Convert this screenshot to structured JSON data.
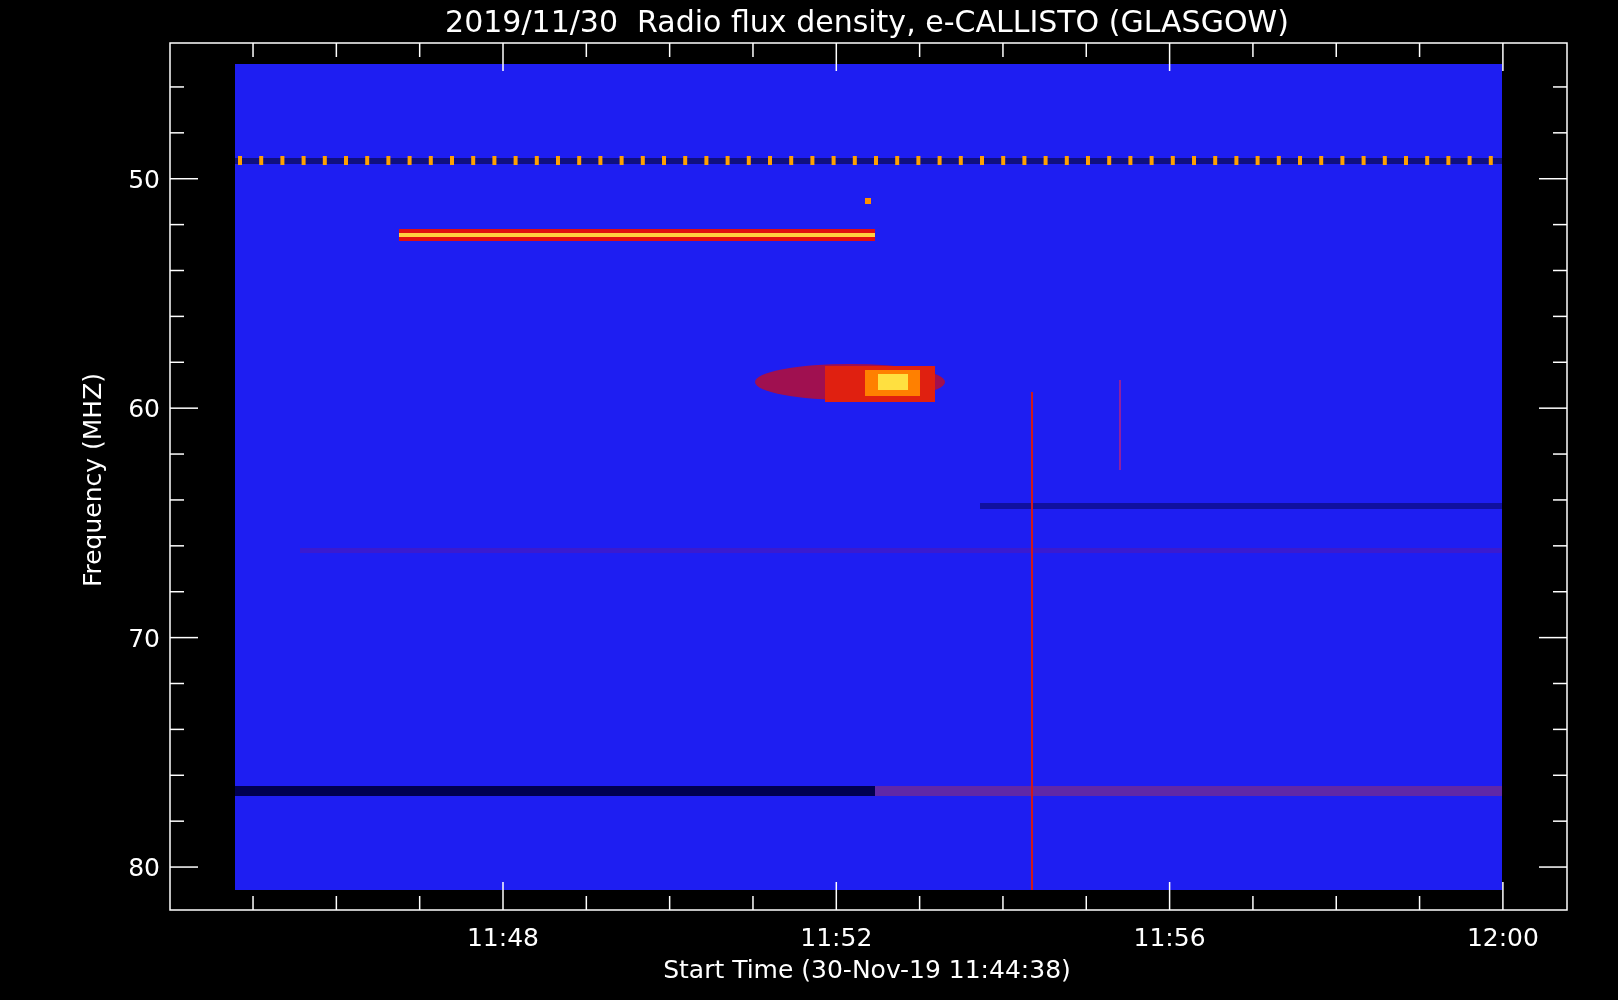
{
  "title": "2019/11/30  Radio flux density, e-CALLISTO (GLASGOW)",
  "y_axis": {
    "label": "Frequency (MHZ)",
    "tick_labels": [
      "50",
      "60",
      "70",
      "80"
    ]
  },
  "x_axis": {
    "label": "Start Time (30-Nov-19 11:44:38)",
    "tick_labels": [
      "11:48",
      "11:52",
      "11:56",
      "12:00"
    ]
  }
}
